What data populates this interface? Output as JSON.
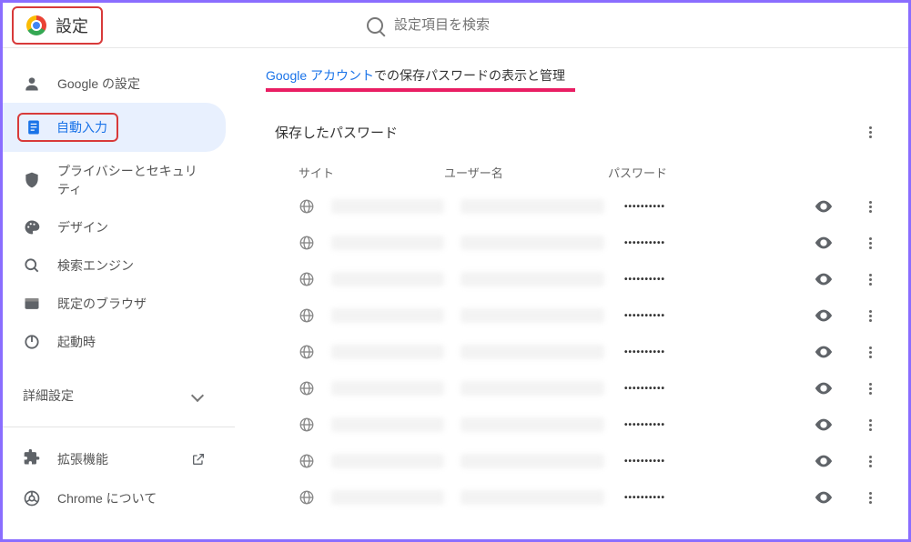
{
  "header": {
    "title": "設定",
    "search_placeholder": "設定項目を検索"
  },
  "sidebar": {
    "items": [
      {
        "icon": "person",
        "label": "Google の設定"
      },
      {
        "icon": "autofill",
        "label": "自動入力"
      },
      {
        "icon": "shield",
        "label": "プライバシーとセキュリティ"
      },
      {
        "icon": "palette",
        "label": "デザイン"
      },
      {
        "icon": "search",
        "label": "検索エンジン"
      },
      {
        "icon": "browser",
        "label": "既定のブラウザ"
      },
      {
        "icon": "power",
        "label": "起動時"
      }
    ],
    "advanced_label": "詳細設定",
    "extensions_label": "拡張機能",
    "about_label": "Chrome について"
  },
  "content": {
    "account_link_prefix": "Google アカウント",
    "account_link_rest": "での保存パスワードの表示と管理",
    "section_title": "保存したパスワード",
    "columns": {
      "site": "サイト",
      "user": "ユーザー名",
      "password": "パスワード"
    },
    "rows": [
      {
        "dots": "••••••••••"
      },
      {
        "dots": "••••••••••"
      },
      {
        "dots": "••••••••••"
      },
      {
        "dots": "••••••••••"
      },
      {
        "dots": "••••••••••"
      },
      {
        "dots": "••••••••••"
      },
      {
        "dots": "••••••••••"
      },
      {
        "dots": "••••••••••"
      },
      {
        "dots": "••••••••••"
      }
    ]
  }
}
